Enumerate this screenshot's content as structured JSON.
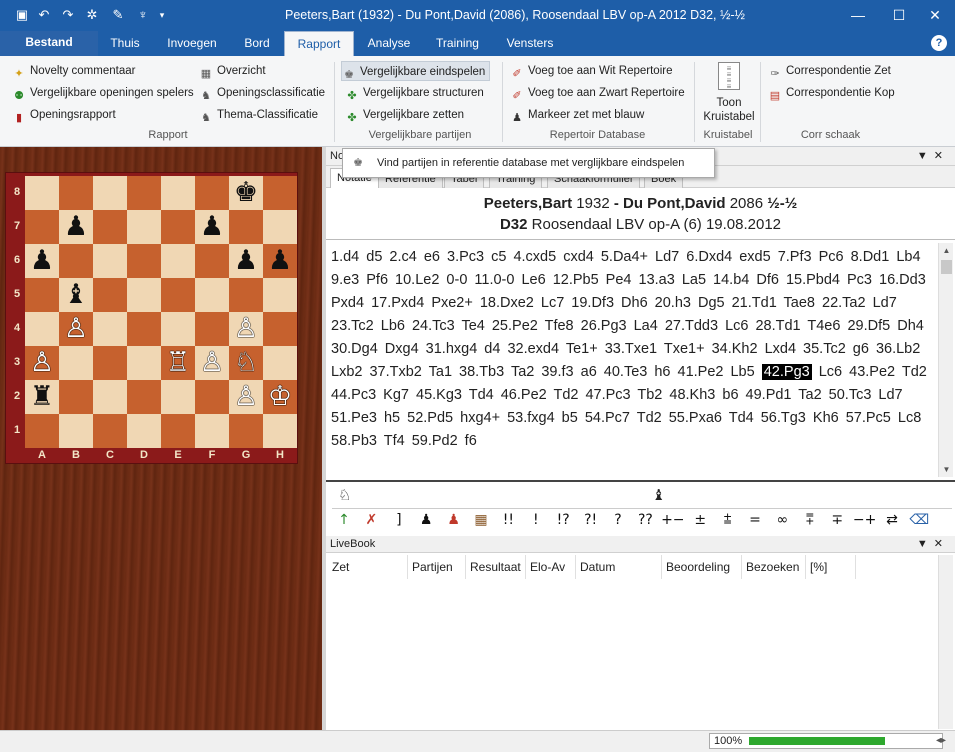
{
  "window": {
    "title": "Peeters,Bart (1932) - Du Pont,David (2086), Roosendaal LBV op-A 2012  D32, ½-½"
  },
  "quick_access": [
    "save",
    "undo",
    "redo",
    "gear",
    "wrench",
    "cup",
    "dropdown"
  ],
  "tabs": {
    "file": "Bestand",
    "items": [
      "Thuis",
      "Invoegen",
      "Bord",
      "Rapport",
      "Analyse",
      "Training",
      "Vensters"
    ],
    "active": "Rapport"
  },
  "ribbon": {
    "rapport": {
      "items": [
        "Novelty commentaar",
        "Vergelijkbare openingen spelers",
        "Openingsrapport",
        "Overzicht",
        "Openingsclassificatie",
        "Thema-Classificatie"
      ],
      "label": "Rapport"
    },
    "vergelijkbare": {
      "items": [
        "Vergelijkbare eindspelen",
        "Vergelijkbare structuren",
        "Vergelijkbare zetten"
      ],
      "label": "Vergelijkbare partijen"
    },
    "repertoir": {
      "items": [
        "Voeg toe aan Wit Repertoire",
        "Voeg toe aan Zwart Repertoire",
        "Markeer zet met blauw"
      ],
      "label": "Repertoir Database"
    },
    "kruistabel": {
      "button": "Toon Kruistabel",
      "label": "Kruistabel"
    },
    "corr": {
      "items": [
        "Correspondentie Zet",
        "Correspondentie Kop"
      ],
      "label": "Corr schaak"
    }
  },
  "tooltip": "Vind partijen in referentie database met verglijkbare eindspelen",
  "notation_pane": {
    "title": "No",
    "subtabs": [
      "Notatie",
      "Referentie",
      "Tabel",
      "Training",
      "Schaakformulier",
      "Boek"
    ],
    "active_subtab": "Notatie"
  },
  "game": {
    "white": "Peeters,Bart",
    "white_elo": "1932",
    "sep": "-",
    "black": "Du Pont,David",
    "black_elo": "2086",
    "result": "½-½",
    "eco": "D32",
    "event": "Roosendaal LBV op-A (6) 19.08.2012",
    "moves_before": "1.d4 d5 2.c4 e6 3.Pc3 c5 4.cxd5 cxd4 5.Da4+ Ld7 6.Dxd4 exd5 7.Pf3 Pc6 8.Dd1 Lb4 9.e3 Pf6 10.Le2 0-0 11.0-0 Le6 12.Pb5 Pe4 13.a3 La5 14.b4 Df6 15.Pbd4 Pc3 16.Dd3 Pxd4 17.Pxd4 Pxe2+ 18.Dxe2 Lc7 19.Df3 Dh6 20.h3 Dg5 21.Td1 Tae8 22.Ta2 Ld7 23.Tc2 Lb6 24.Tc3 Te4 25.Pe2 Tfe8 26.Pg3 La4 27.Tdd3 Lc6 28.Td1 T4e6 29.Df5 Dh4 30.Dg4 Dxg4 31.hxg4 d4 32.exd4 Te1+ 33.Txe1 Txe1+ 34.Kh2 Lxd4 35.Tc2 g6 36.Lb2 Lxb2 37.Txb2 Ta1 38.Tb3 Ta2 39.f3 a6 40.Te3 h6 41.Pe2 Lb5",
    "current_move": "42.Pg3",
    "moves_after": "Lc6 43.Pe2 Td2 44.Pc3 Kg7 45.Kg3 Td4 46.Pe2 Td2 47.Pc3 Tb2 48.Kh3 b6 49.Pd1 Ta2 50.Tc3 Ld7 51.Pe3 h5 52.Pd5 hxg4+ 53.fxg4 b5 54.Pc7 Td2 55.Pxa6 Td4 56.Tg3 Kh6 57.Pc5 Lc8 58.Pb3 Tf4 59.Pd2 f6"
  },
  "board": {
    "ranks": [
      "8",
      "7",
      "6",
      "5",
      "4",
      "3",
      "2",
      "1"
    ],
    "files": [
      "A",
      "B",
      "C",
      "D",
      "E",
      "F",
      "G",
      "H"
    ],
    "pieces": [
      {
        "sq": "g8",
        "glyph": "♚",
        "color": "b"
      },
      {
        "sq": "b7",
        "glyph": "♟",
        "color": "b"
      },
      {
        "sq": "f7",
        "glyph": "♟",
        "color": "b"
      },
      {
        "sq": "a6",
        "glyph": "♟",
        "color": "b"
      },
      {
        "sq": "g6",
        "glyph": "♟",
        "color": "b"
      },
      {
        "sq": "h6",
        "glyph": "♟",
        "color": "b"
      },
      {
        "sq": "b5",
        "glyph": "♝",
        "color": "b"
      },
      {
        "sq": "b4",
        "glyph": "♙",
        "color": "w"
      },
      {
        "sq": "g4",
        "glyph": "♙",
        "color": "w"
      },
      {
        "sq": "a3",
        "glyph": "♙",
        "color": "w"
      },
      {
        "sq": "e3",
        "glyph": "♖",
        "color": "w"
      },
      {
        "sq": "f3",
        "glyph": "♙",
        "color": "w"
      },
      {
        "sq": "g3",
        "glyph": "♘",
        "color": "w"
      },
      {
        "sq": "a2",
        "glyph": "♜",
        "color": "b"
      },
      {
        "sq": "g2",
        "glyph": "♙",
        "color": "w"
      },
      {
        "sq": "h2",
        "glyph": "♔",
        "color": "w"
      }
    ]
  },
  "symbols_row1": [
    "white-knight",
    "black-bishop"
  ],
  "symbols": [
    "↑",
    "✗",
    "]",
    "♟",
    "♟",
    "▦",
    "!!",
    "!",
    "!?",
    "?!",
    "?",
    "??",
    "+−",
    "±",
    "⩲",
    "=",
    "∞",
    "⩱",
    "∓",
    "−+",
    "⇄",
    "⌫"
  ],
  "livebook": {
    "title": "LiveBook",
    "columns": [
      "Zet",
      "Partijen",
      "Resultaat",
      "Elo-Av",
      "Datum",
      "Beoordeling",
      "Bezoeken",
      "[%]"
    ]
  },
  "status": {
    "zoom": "100%",
    "progress": 1.0
  },
  "colors": {
    "accent": "#1e5ea8",
    "board_light": "#f0d7b4",
    "board_dark": "#c6612e",
    "progress": "#2ea82e"
  }
}
